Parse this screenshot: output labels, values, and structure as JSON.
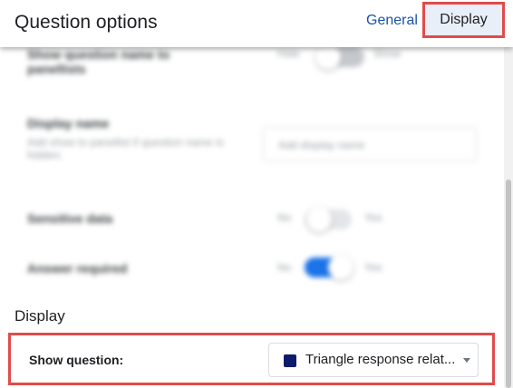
{
  "header": {
    "title": "Question options",
    "tabs": [
      {
        "label": "General",
        "active": false
      },
      {
        "label": "Display",
        "active": true
      }
    ]
  },
  "blurred_settings": {
    "show_name_label": "Show question name to panellists",
    "show_name_off": "Hide",
    "show_name_on": "Show",
    "display_name_label": "Display name",
    "display_name_help": "Add show to panellist if question name is hidden.",
    "display_name_placeholder": "Add display name",
    "sensitive_label": "Sensitive data",
    "sensitive_no": "No",
    "sensitive_yes": "Yes",
    "answer_required_label": "Answer required",
    "answer_required_no": "No",
    "answer_required_yes": "Yes"
  },
  "display_section": {
    "heading": "Display",
    "show_question_label": "Show question:",
    "show_question_value": "Triangle response relat...",
    "swatch_color": "#0d1b6b"
  },
  "colors": {
    "highlight_border": "#e14b4b",
    "link_blue": "#1a53a8",
    "toggle_on": "#1a73e8"
  }
}
